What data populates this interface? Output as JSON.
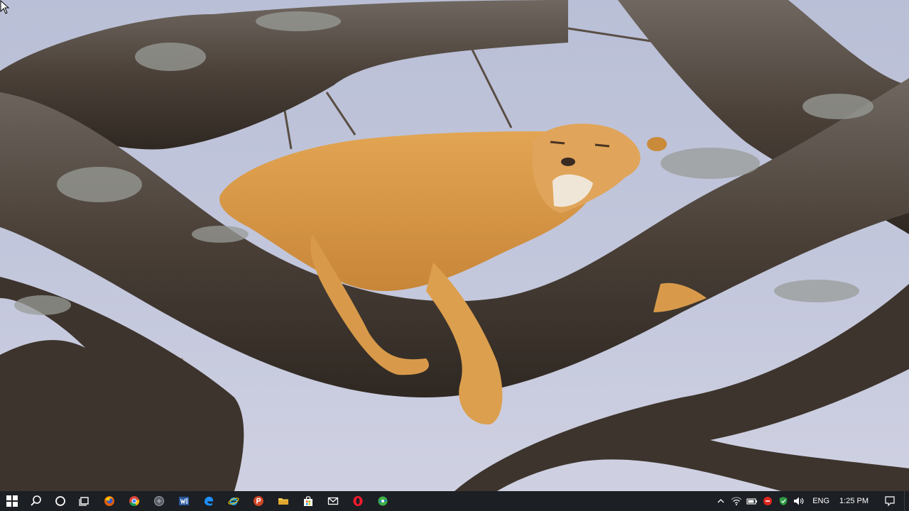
{
  "wallpaper": {
    "subject": "lioness-sleeping-on-tree-branch",
    "colors": {
      "sky": "#c3c7dc",
      "bark": "#4a4038",
      "lichen": "#9a9c98",
      "fur": "#d99a48"
    }
  },
  "taskbar": {
    "background": "#1c1f24",
    "start": {
      "icon": "windows-logo-icon"
    },
    "search": {
      "icon": "search-icon"
    },
    "cortana": {
      "icon": "cortana-circle-icon"
    },
    "task_view": {
      "icon": "task-view-icon"
    },
    "pinned_apps": [
      {
        "name": "firefox",
        "icon": "firefox-icon",
        "color": "#e66000"
      },
      {
        "name": "chrome",
        "icon": "chrome-icon",
        "color": "#fbbc05"
      },
      {
        "name": "app-gray",
        "icon": "gray-circle-app-icon",
        "color": "#888888"
      },
      {
        "name": "word",
        "icon": "word-icon",
        "color": "#2b579a"
      },
      {
        "name": "edge",
        "icon": "edge-icon",
        "color": "#1e90ff"
      },
      {
        "name": "internet-explorer",
        "icon": "internet-explorer-icon",
        "color": "#1fa0e8"
      },
      {
        "name": "powerpoint",
        "icon": "powerpoint-icon",
        "color": "#d24726"
      },
      {
        "name": "file-explorer",
        "icon": "folder-icon",
        "color": "#f7c948"
      },
      {
        "name": "store",
        "icon": "store-bag-icon",
        "color": "#ffffff"
      },
      {
        "name": "mail",
        "icon": "mail-icon",
        "color": "#ffffff"
      },
      {
        "name": "opera",
        "icon": "opera-icon",
        "color": "#ff1b2d"
      },
      {
        "name": "green-app",
        "icon": "green-app-icon",
        "color": "#3db14a"
      }
    ],
    "tray": {
      "chevron_icon": "chevron-up-icon",
      "icons": [
        "wifi-icon",
        "battery-icon",
        "red-badge-icon",
        "shield-icon",
        "volume-icon"
      ],
      "language": "ENG",
      "time": "1:25 PM",
      "notification_icon": "action-center-icon"
    }
  }
}
